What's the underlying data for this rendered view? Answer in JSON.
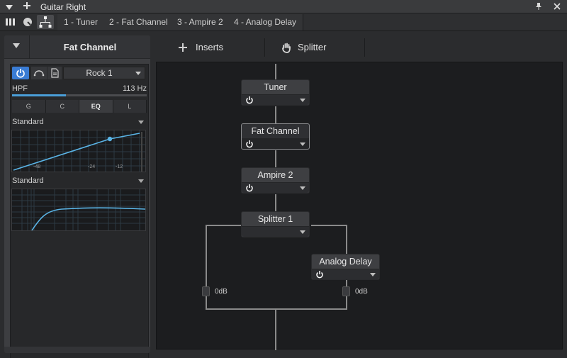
{
  "window": {
    "title": "Guitar Right"
  },
  "toolbar": {
    "tabs": [
      {
        "label": "1 - Tuner"
      },
      {
        "label": "2 - Fat Channel"
      },
      {
        "label": "3 - Ampire 2"
      },
      {
        "label": "4 - Analog Delay"
      }
    ]
  },
  "device_panel": {
    "name": "Fat Channel",
    "preset": "Rock 1",
    "hpf": {
      "label": "HPF",
      "value": "113 Hz",
      "fill_fraction": 0.4
    },
    "sections": [
      {
        "label": "G",
        "selected": false
      },
      {
        "label": "C",
        "selected": false
      },
      {
        "label": "EQ",
        "selected": true
      },
      {
        "label": "L",
        "selected": false
      }
    ],
    "comp_mode": "Standard",
    "comp_ticks": [
      "-48",
      "-24",
      "-12"
    ],
    "eq_mode": "Standard"
  },
  "routing": {
    "tabs": {
      "inserts": "Inserts",
      "splitter": "Splitter"
    },
    "nodes": {
      "tuner": "Tuner",
      "fat_channel": "Fat Channel",
      "ampire": "Ampire 2",
      "splitter": "Splitter 1",
      "delay": "Analog Delay"
    },
    "gain_left": "0dB",
    "gain_right": "0dB"
  },
  "colors": {
    "accent": "#3a7cd4",
    "curve": "#5ab4e6"
  },
  "icons": {
    "collapse": "triangle-down-icon",
    "add": "plus-icon",
    "pin": "pin-icon",
    "close": "close-icon",
    "mixer": "mixer-icon",
    "browser": "dial-icon",
    "routing": "routing-icon",
    "hand": "hand-icon",
    "power": "power-icon"
  }
}
